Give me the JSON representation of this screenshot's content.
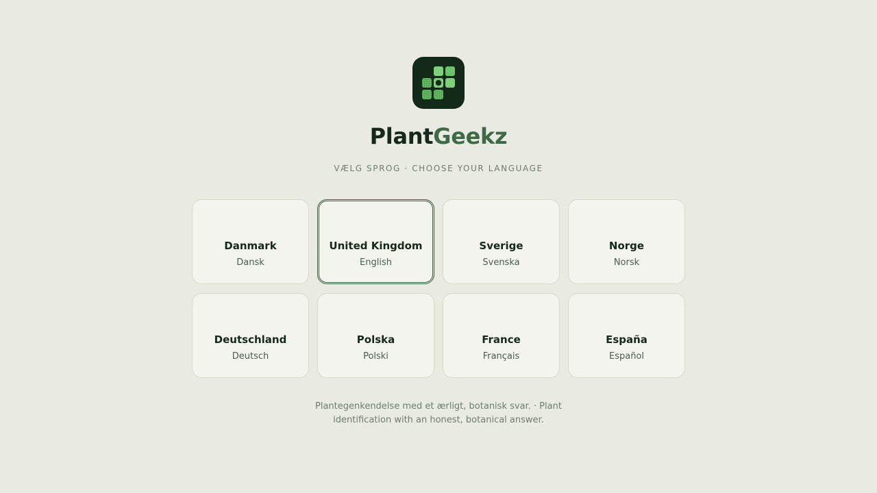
{
  "brand": {
    "name_part1": "Plant",
    "name_part2": "Geekz",
    "logo_icon": "plant-grid-icon",
    "colors": {
      "logo_bg": "#142a18",
      "accent": "#3f6a48",
      "accent_light": "#7ed07a"
    }
  },
  "subtitle": "VÆLG SPROG · CHOOSE YOUR LANGUAGE",
  "languages": [
    {
      "country": "Danmark",
      "language": "Dansk",
      "selected": false
    },
    {
      "country": "United Kingdom",
      "language": "English",
      "selected": true
    },
    {
      "country": "Sverige",
      "language": "Svenska",
      "selected": false
    },
    {
      "country": "Norge",
      "language": "Norsk",
      "selected": false
    },
    {
      "country": "Deutschland",
      "language": "Deutsch",
      "selected": false
    },
    {
      "country": "Polska",
      "language": "Polski",
      "selected": false
    },
    {
      "country": "France",
      "language": "Français",
      "selected": false
    },
    {
      "country": "España",
      "language": "Español",
      "selected": false
    }
  ],
  "footer": "Plantegenkendelse med et ærligt, botanisk svar. · Plant identification with an honest, botanical answer."
}
